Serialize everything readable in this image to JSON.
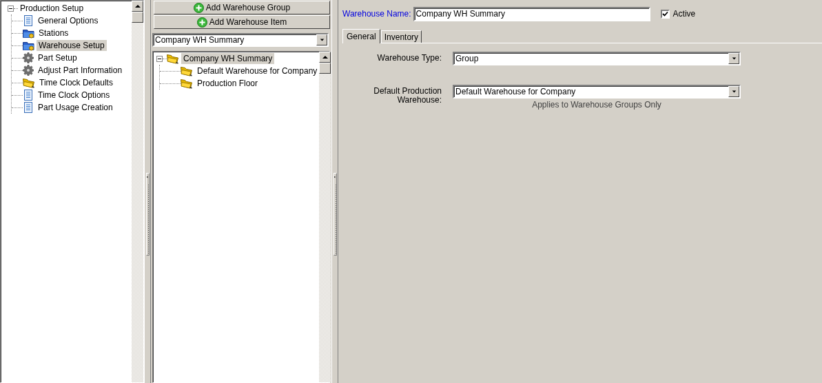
{
  "setup_tree": {
    "label": "Production Setup",
    "expanded": true,
    "selected": false,
    "children": [
      {
        "label": "General Options",
        "kind": "document",
        "selected": false
      },
      {
        "label": "Stations",
        "kind": "blue-folder",
        "selected": false
      },
      {
        "label": "Warehouse Setup",
        "kind": "blue-folder",
        "selected": true
      },
      {
        "label": "Part Setup",
        "kind": "gear",
        "selected": false
      },
      {
        "label": "Adjust Part Information",
        "kind": "gear",
        "selected": false
      },
      {
        "label": "Time Clock Defaults",
        "kind": "yellow-folder",
        "selected": false
      },
      {
        "label": "Time Clock Options",
        "kind": "document",
        "selected": false
      },
      {
        "label": "Part Usage Creation",
        "kind": "document",
        "selected": false
      }
    ]
  },
  "toolbar": {
    "buttons": [
      "Add Warehouse Group",
      "Add Warehouse Item"
    ]
  },
  "warehouse_select": {
    "value": "Company WH Summary"
  },
  "warehouse_tree": {
    "label": "Company WH Summary",
    "kind": "yellow-folder",
    "expanded": true,
    "selected": true,
    "children": [
      {
        "label": "Default Warehouse for Company",
        "kind": "yellow-folder",
        "selected": false
      },
      {
        "label": "Production Floor",
        "kind": "yellow-folder",
        "selected": false
      }
    ]
  },
  "form": {
    "name_label": "Warehouse Name:",
    "name_value": "Company WH Summary",
    "active": {
      "label": "Active",
      "checked": true
    }
  },
  "tabs": [
    {
      "label": "General",
      "selected": true
    },
    {
      "label": "Inventory",
      "selected": false
    }
  ],
  "fields": [
    {
      "label": "Warehouse Type:",
      "value": "Group"
    },
    {
      "label": "Default Production Warehouse:",
      "value": "Default Warehouse for Company",
      "note": "Applies to Warehouse Groups Only"
    }
  ]
}
